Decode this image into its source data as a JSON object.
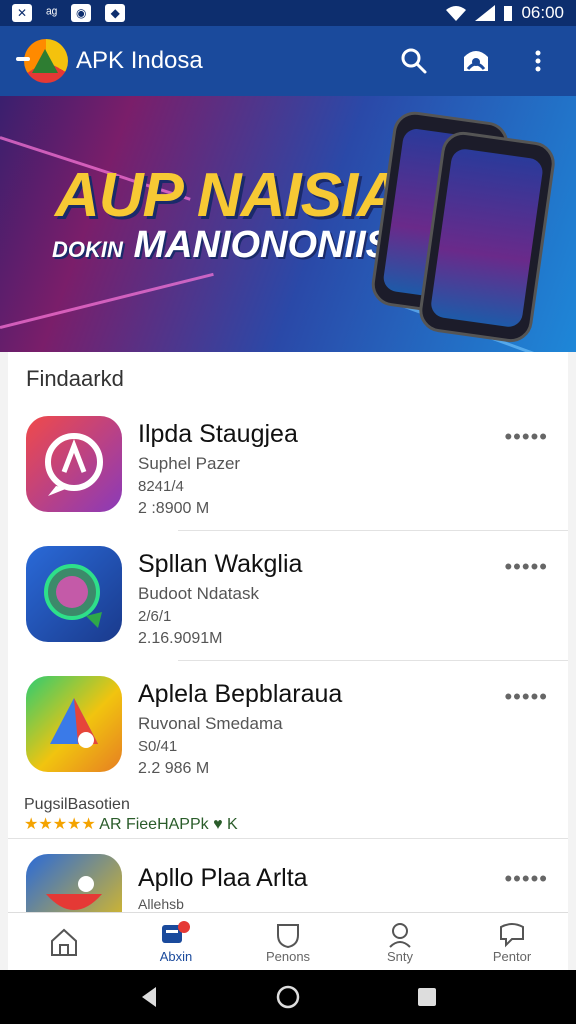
{
  "status": {
    "time": "06:00",
    "icons": [
      "x-icon",
      "signal-icon",
      "portrait-icon",
      "shield-icon"
    ]
  },
  "appbar": {
    "title": "APK Indosa"
  },
  "banner": {
    "title": "AUP NAISIAI",
    "subtitle_small": "DOKIN",
    "subtitle": "MANIONONIISIA"
  },
  "section": {
    "title": "Findaarkd"
  },
  "apps": [
    {
      "name": "Ilpda Staugjea",
      "dev": "Suphel Pazer",
      "ver": "8241/4",
      "size": "2 :8900 M"
    },
    {
      "name": "Spllan Wakglia",
      "dev": "Budoot Ndatask",
      "ver": "2/6/1",
      "size": "2.16.9091M"
    },
    {
      "name": "Aplela Bepblaraua",
      "dev": "Ruvonal Smedama",
      "ver": "S0/41",
      "size": "2.2 986 M"
    },
    {
      "name": "Apllo Plaa Arlta",
      "dev": "Allehsb",
      "ver": "",
      "size": ""
    }
  ],
  "promo": {
    "label": "PugsilBasotien",
    "stars": "★★★★★",
    "text": "AR FieeHAPPk ♥ K"
  },
  "nav": [
    {
      "label": "",
      "icon": "home-icon"
    },
    {
      "label": "Abxin",
      "icon": "apps-icon"
    },
    {
      "label": "Penons",
      "icon": "shield-icon"
    },
    {
      "label": "Snty",
      "icon": "person-icon"
    },
    {
      "label": "Pentor",
      "icon": "chat-icon"
    }
  ],
  "colors": {
    "primary": "#1a4a9c",
    "status": "#0d2e6e",
    "accent": "#f7c934"
  }
}
